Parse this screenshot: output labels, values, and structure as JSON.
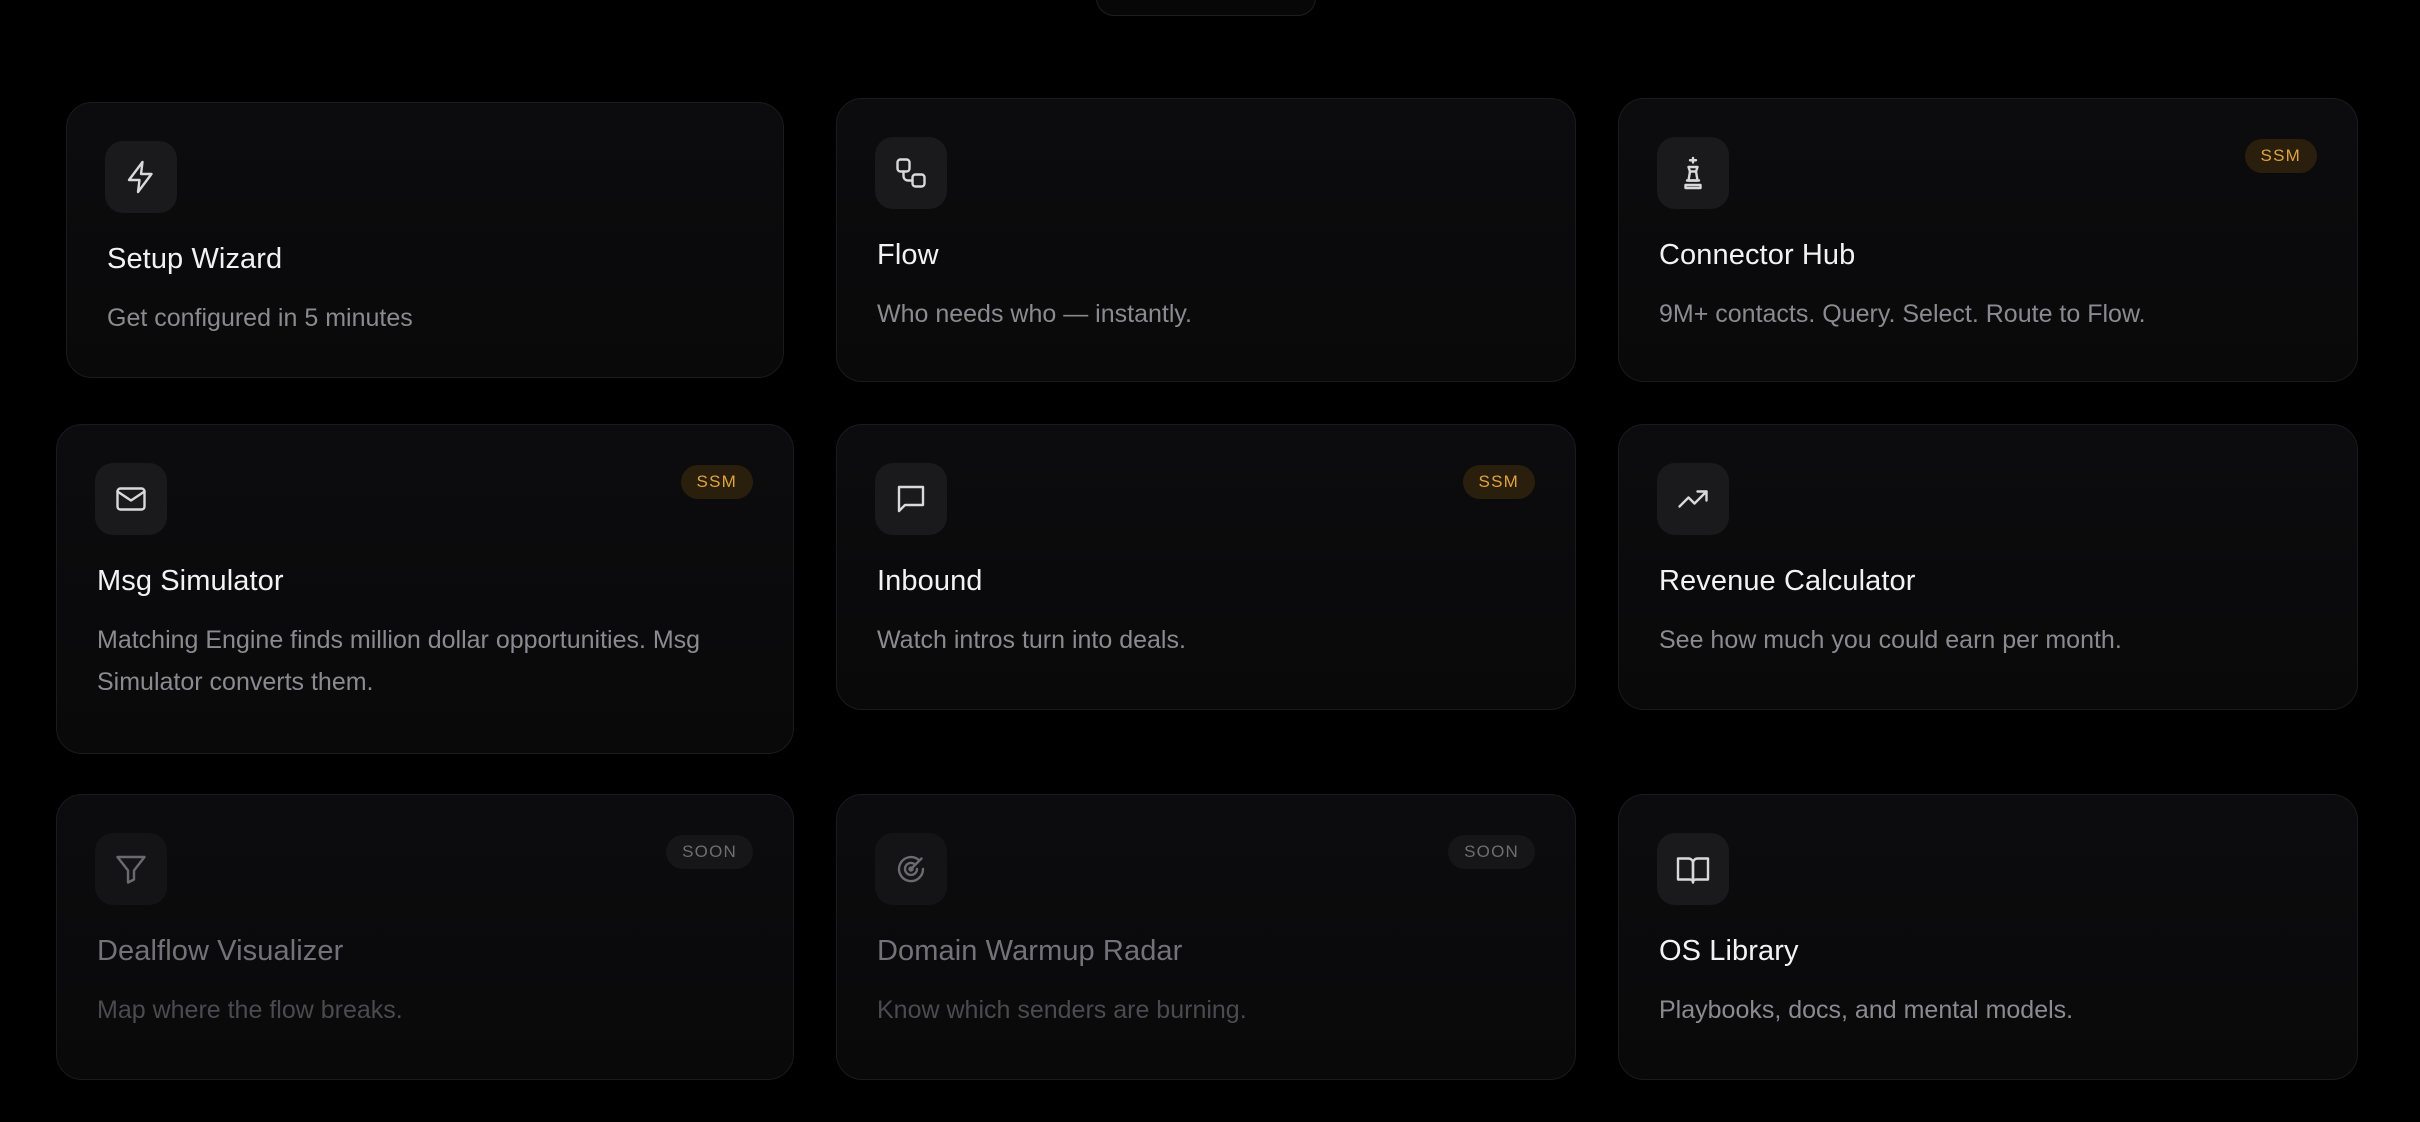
{
  "cards": [
    {
      "title": "Setup Wizard",
      "description": "Get configured in 5 minutes",
      "icon": "lightning-icon"
    },
    {
      "title": "Flow",
      "description": "Who needs who — instantly.",
      "icon": "flow-nodes-icon"
    },
    {
      "title": "Connector Hub",
      "description": "9M+ contacts. Query. Select. Route to Flow.",
      "icon": "chess-piece-icon",
      "badge": "SSM"
    },
    {
      "title": "Msg Simulator",
      "description": "Matching Engine finds million dollar opportunities. Msg Simulator converts them.",
      "icon": "mail-icon",
      "badge": "SSM"
    },
    {
      "title": "Inbound",
      "description": "Watch intros turn into deals.",
      "icon": "chat-bubble-icon",
      "badge": "SSM"
    },
    {
      "title": "Revenue Calculator",
      "description": "See how much you could earn per month.",
      "icon": "trend-up-icon"
    },
    {
      "title": "Dealflow Visualizer",
      "description": "Map where the flow breaks.",
      "icon": "funnel-icon",
      "badge": "SOON"
    },
    {
      "title": "Domain Warmup Radar",
      "description": "Know which senders are burning.",
      "icon": "radar-icon",
      "badge": "SOON"
    },
    {
      "title": "OS Library",
      "description": "Playbooks, docs, and mental models.",
      "icon": "book-icon"
    }
  ],
  "colors": {
    "ssm_badge": "#e0a341",
    "soon_badge": "#6d6d72",
    "background": "#000000"
  }
}
